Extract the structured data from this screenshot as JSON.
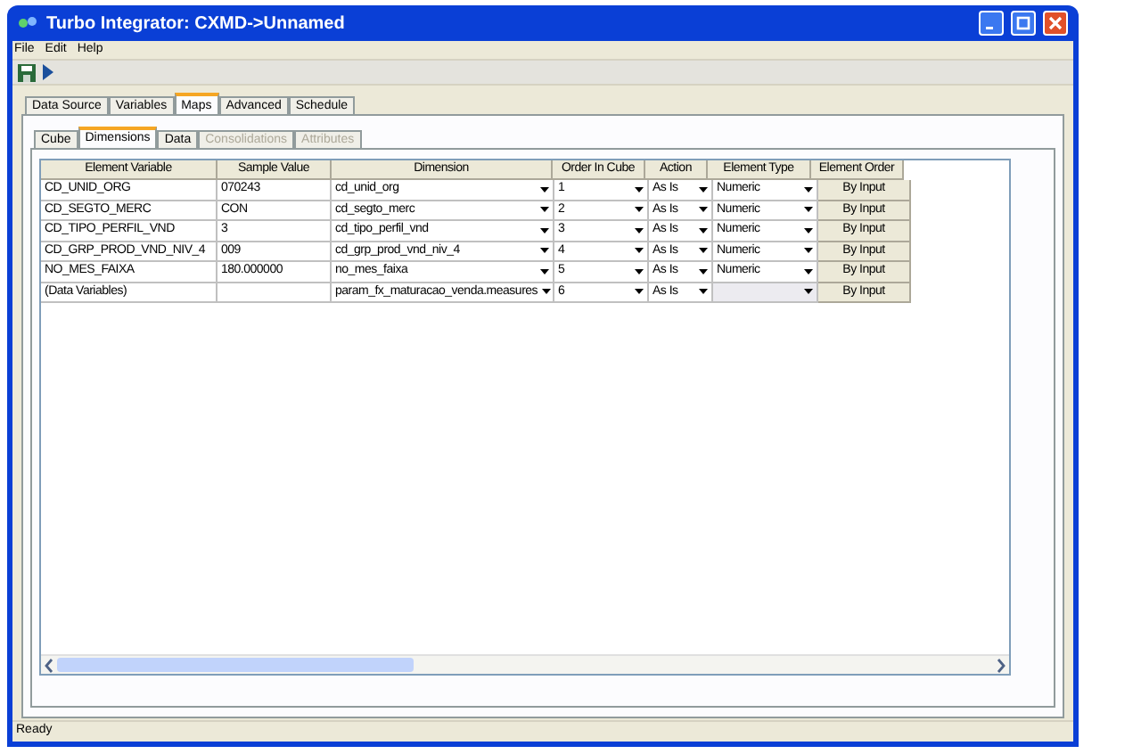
{
  "window": {
    "title": "Turbo Integrator:  CXMD->Unnamed"
  },
  "menu": [
    "File",
    "Edit",
    "Help"
  ],
  "tabs": [
    {
      "label": "Data Source",
      "selected": false
    },
    {
      "label": "Variables",
      "selected": false
    },
    {
      "label": "Maps",
      "selected": true
    },
    {
      "label": "Advanced",
      "selected": false
    },
    {
      "label": "Schedule",
      "selected": false
    }
  ],
  "subtabs": [
    {
      "label": "Cube",
      "selected": false,
      "disabled": false
    },
    {
      "label": "Dimensions",
      "selected": true,
      "disabled": false
    },
    {
      "label": "Data",
      "selected": false,
      "disabled": false
    },
    {
      "label": "Consolidations",
      "selected": false,
      "disabled": true
    },
    {
      "label": "Attributes",
      "selected": false,
      "disabled": true
    }
  ],
  "table": {
    "columns": [
      "Element Variable",
      "Sample Value",
      "Dimension",
      "Order In Cube",
      "Action",
      "Element Type",
      "Element Order"
    ],
    "rows": [
      {
        "element_variable": "CD_UNID_ORG",
        "sample_value": "070243",
        "dimension": "cd_unid_org",
        "order": "1",
        "action": "As Is",
        "element_type": "Numeric",
        "element_order": "By Input"
      },
      {
        "element_variable": "CD_SEGTO_MERC",
        "sample_value": "CON",
        "dimension": "cd_segto_merc",
        "order": "2",
        "action": "As Is",
        "element_type": "Numeric",
        "element_order": "By Input"
      },
      {
        "element_variable": "CD_TIPO_PERFIL_VND",
        "sample_value": "3",
        "dimension": "cd_tipo_perfil_vnd",
        "order": "3",
        "action": "As Is",
        "element_type": "Numeric",
        "element_order": "By Input"
      },
      {
        "element_variable": "CD_GRP_PROD_VND_NIV_4",
        "sample_value": "009",
        "dimension": "cd_grp_prod_vnd_niv_4",
        "order": "4",
        "action": "As Is",
        "element_type": "Numeric",
        "element_order": "By Input"
      },
      {
        "element_variable": "NO_MES_FAIXA",
        "sample_value": "180.000000",
        "dimension": "no_mes_faixa",
        "order": "5",
        "action": "As Is",
        "element_type": "Numeric",
        "element_order": "By Input"
      },
      {
        "element_variable": "(Data Variables)",
        "dimension": "param_fx_maturacao_venda.measures",
        "order": "6",
        "action": "As Is",
        "element_order": "By Input"
      }
    ]
  },
  "status_bar": "Ready"
}
